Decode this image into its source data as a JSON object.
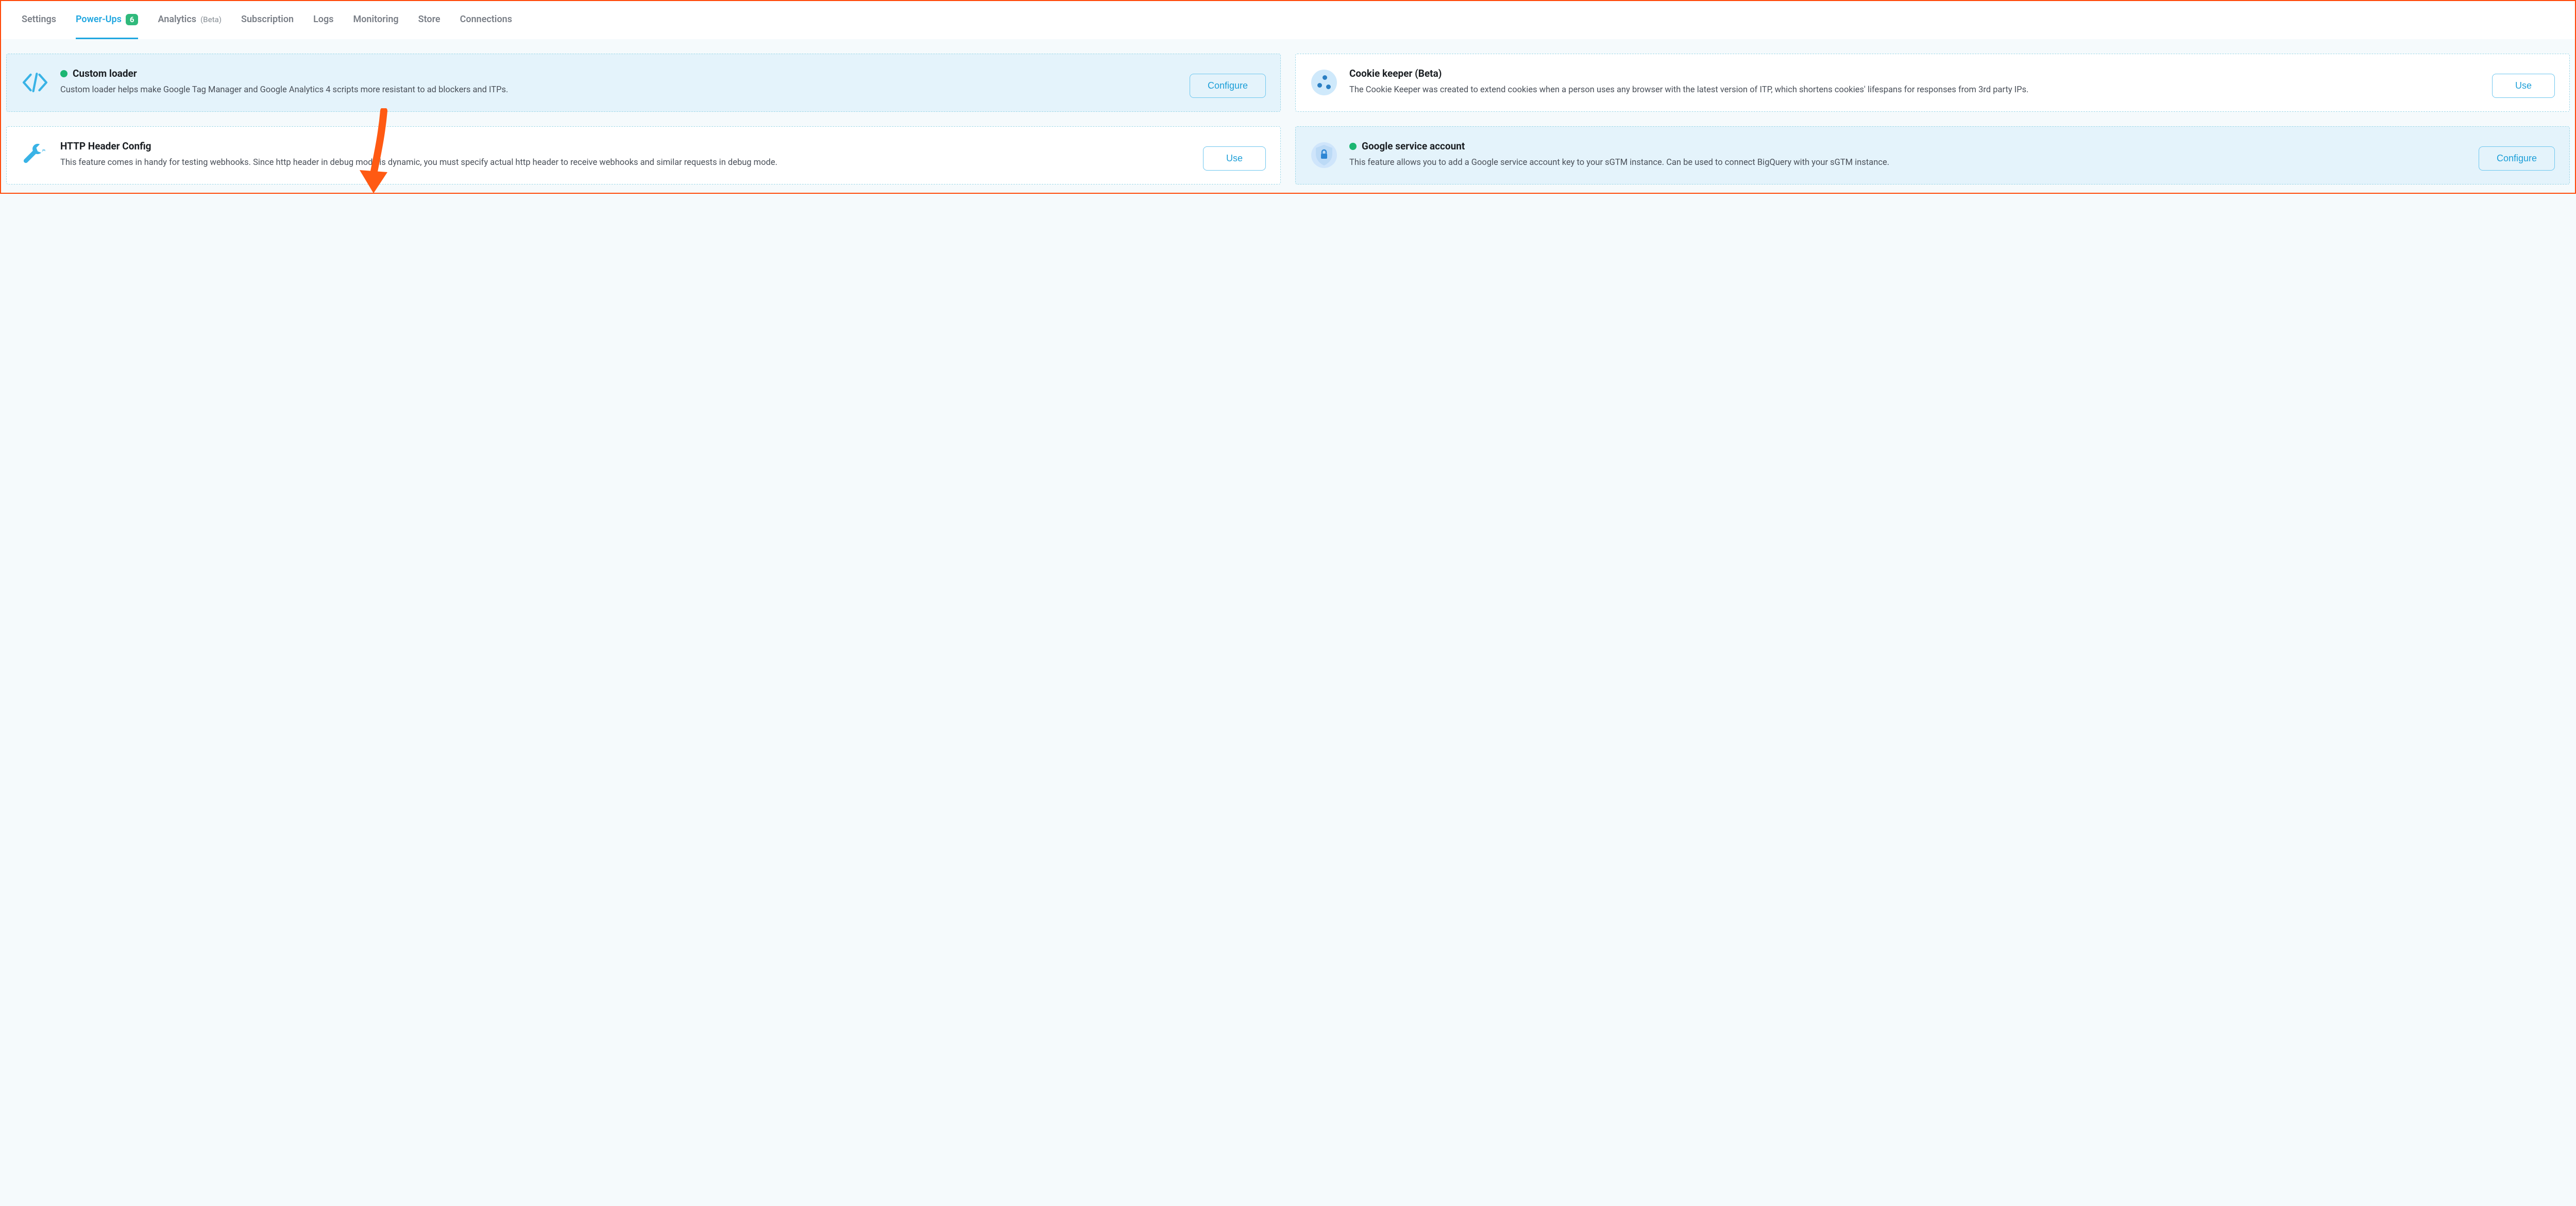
{
  "tabs": {
    "settings": "Settings",
    "powerups": "Power-Ups",
    "powerups_badge": "6",
    "analytics": "Analytics",
    "analytics_beta": "(Beta)",
    "subscription": "Subscription",
    "logs": "Logs",
    "monitoring": "Monitoring",
    "store": "Store",
    "connections": "Connections"
  },
  "cards": {
    "custom_loader": {
      "title": "Custom loader",
      "desc": "Custom loader helps make Google Tag Manager and Google Analytics 4 scripts more resistant to ad blockers and ITPs.",
      "button": "Configure"
    },
    "cookie_keeper": {
      "title": "Cookie keeper (Beta)",
      "desc": "The Cookie Keeper was created to extend cookies when a person uses any browser with the latest version of ITP, which shortens cookies' lifespans for responses from 3rd party IPs.",
      "button": "Use"
    },
    "http_header": {
      "title": "HTTP Header Config",
      "desc": "This feature comes in handy for testing webhooks. Since http header in debug mode is dynamic, you must specify actual http header to receive webhooks and similar requests in debug mode.",
      "button": "Use"
    },
    "google_service": {
      "title": "Google service account",
      "desc": "This feature allows you to add a Google service account key to your sGTM instance. Can be used to connect BigQuery with your sGTM instance.",
      "button": "Configure"
    }
  }
}
